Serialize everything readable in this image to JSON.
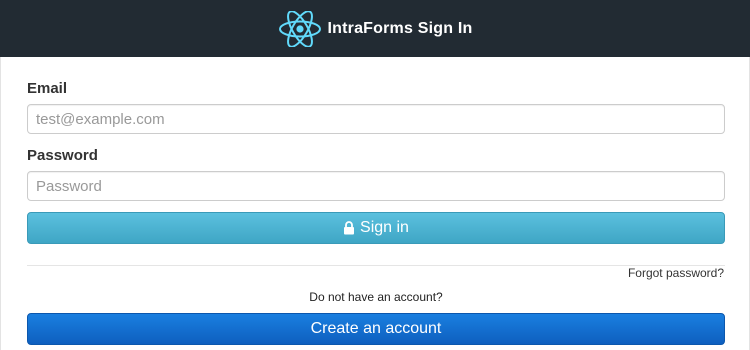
{
  "header": {
    "title": "IntraForms Sign In",
    "logo_icon": "react-atom-icon"
  },
  "form": {
    "email_label": "Email",
    "email_placeholder": "test@example.com",
    "email_value": "",
    "password_label": "Password",
    "password_placeholder": "Password",
    "password_value": "",
    "signin_label": "Sign in",
    "signin_icon": "lock-icon",
    "forgot_label": "Forgot password?",
    "no_account_text": "Do not have an account?",
    "create_label": "Create an account"
  },
  "colors": {
    "header_bg": "#222b33",
    "logo": "#61dafb",
    "signin_button": "#5bc0de",
    "create_button": "#1a7fe0"
  }
}
